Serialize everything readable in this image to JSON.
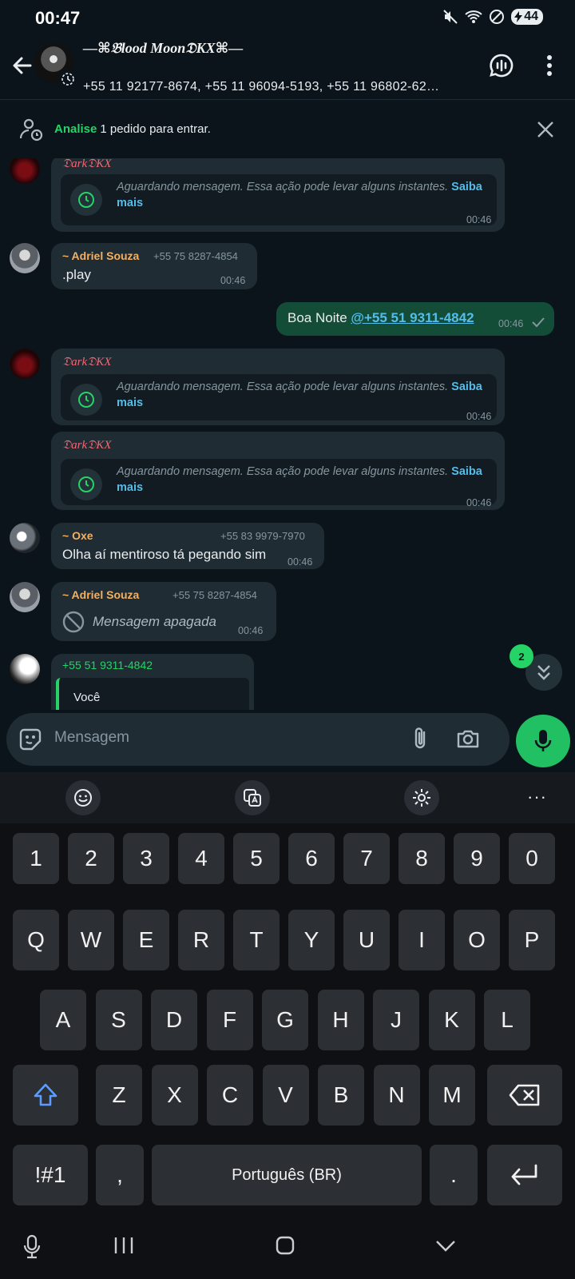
{
  "status_bar": {
    "time": "00:47",
    "battery": "44"
  },
  "header": {
    "title": "—⌘𝔅lood Moon𝔇KX⌘—",
    "members": "+55 11 92177-8674, +55 11 96094-5193, +55 11 96802-62…"
  },
  "request_banner": {
    "link": "Analise",
    "text": "1 pedido para entrar."
  },
  "messages": [
    {
      "sender": "𝔇ark𝔇KX",
      "waiting_text": "Aguardando mensagem. Essa ação pode levar alguns instantes.",
      "more": "Saiba mais",
      "time": "00:46"
    },
    {
      "sender": "~ Adriel Souza",
      "number": "+55 75 8287-4854",
      "text": ".play",
      "time": "00:46"
    },
    {
      "text": "Boa Noite ",
      "mention": "@+55 51 9311-4842",
      "time": "00:46"
    },
    {
      "sender": "𝔇ark𝔇KX",
      "waiting_text": "Aguardando mensagem. Essa ação pode levar alguns instantes.",
      "more": "Saiba mais",
      "time": "00:46"
    },
    {
      "sender": "𝔇ark𝔇KX",
      "waiting_text": "Aguardando mensagem. Essa ação pode levar alguns instantes.",
      "more": "Saiba mais",
      "time": "00:46"
    },
    {
      "sender": "~ Oxe",
      "number": "+55 83 9979-7970",
      "text": "Olha aí mentiroso tá pegando sim",
      "time": "00:46"
    },
    {
      "sender": "~ Adriel Souza",
      "number": "+55 75 8287-4854",
      "text": "Mensagem apagada",
      "time": "00:46"
    },
    {
      "sender": "+55 51 9311-4842",
      "quote": "Você"
    }
  ],
  "unread_count": "2",
  "composer": {
    "placeholder": "Mensagem"
  },
  "keyboard": {
    "row_numbers": [
      "1",
      "2",
      "3",
      "4",
      "5",
      "6",
      "7",
      "8",
      "9",
      "0"
    ],
    "row_1": [
      "Q",
      "W",
      "E",
      "R",
      "T",
      "Y",
      "U",
      "I",
      "O",
      "P"
    ],
    "row_2": [
      "A",
      "S",
      "D",
      "F",
      "G",
      "H",
      "J",
      "K",
      "L"
    ],
    "row_3": [
      "Z",
      "X",
      "C",
      "V",
      "B",
      "N",
      "M"
    ],
    "symbols": "!#1",
    "comma": ",",
    "space": "Português (BR)",
    "period": "."
  },
  "colors": {
    "accent": "#25d366",
    "bubble_in": "#1f2c33",
    "bubble_out": "#144d37",
    "link": "#53bdeb"
  }
}
